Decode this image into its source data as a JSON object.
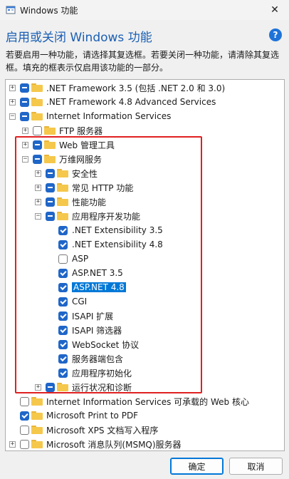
{
  "window": {
    "title": "Windows 功能",
    "close_glyph": "✕"
  },
  "heading": "启用或关闭 Windows 功能",
  "help_glyph": "?",
  "description": "若要启用一种功能，请选择其复选框。若要关闭一种功能，请清除其复选框。填充的框表示仅启用该功能的一部分。",
  "tree": [
    {
      "label": ".NET Framework 3.5 (包括 .NET 2.0 和 3.0)",
      "level": 0,
      "expander": "+",
      "state": "partial",
      "selected": false
    },
    {
      "label": ".NET Framework 4.8 Advanced Services",
      "level": 0,
      "expander": "+",
      "state": "partial",
      "selected": false
    },
    {
      "label": "Internet Information Services",
      "level": 0,
      "expander": "−",
      "state": "partial",
      "selected": false
    },
    {
      "label": "FTP 服务器",
      "level": 1,
      "expander": "+",
      "state": "unchecked",
      "selected": false
    },
    {
      "label": "Web 管理工具",
      "level": 1,
      "expander": "+",
      "state": "partial",
      "selected": false
    },
    {
      "label": "万维网服务",
      "level": 1,
      "expander": "−",
      "state": "partial",
      "selected": false
    },
    {
      "label": "安全性",
      "level": 2,
      "expander": "+",
      "state": "partial",
      "selected": false
    },
    {
      "label": "常见 HTTP 功能",
      "level": 2,
      "expander": "+",
      "state": "partial",
      "selected": false
    },
    {
      "label": "性能功能",
      "level": 2,
      "expander": "+",
      "state": "partial",
      "selected": false
    },
    {
      "label": "应用程序开发功能",
      "level": 2,
      "expander": "−",
      "state": "partial",
      "selected": false
    },
    {
      "label": ".NET Extensibility 3.5",
      "level": 3,
      "expander": "",
      "state": "checked",
      "selected": false
    },
    {
      "label": ".NET Extensibility 4.8",
      "level": 3,
      "expander": "",
      "state": "checked",
      "selected": false
    },
    {
      "label": "ASP",
      "level": 3,
      "expander": "",
      "state": "unchecked",
      "selected": false
    },
    {
      "label": "ASP.NET 3.5",
      "level": 3,
      "expander": "",
      "state": "checked",
      "selected": false
    },
    {
      "label": "ASP.NET 4.8",
      "level": 3,
      "expander": "",
      "state": "checked",
      "selected": true
    },
    {
      "label": "CGI",
      "level": 3,
      "expander": "",
      "state": "checked",
      "selected": false
    },
    {
      "label": "ISAPI 扩展",
      "level": 3,
      "expander": "",
      "state": "checked",
      "selected": false
    },
    {
      "label": "ISAPI 筛选器",
      "level": 3,
      "expander": "",
      "state": "checked",
      "selected": false
    },
    {
      "label": "WebSocket 协议",
      "level": 3,
      "expander": "",
      "state": "checked",
      "selected": false
    },
    {
      "label": "服务器端包含",
      "level": 3,
      "expander": "",
      "state": "checked",
      "selected": false
    },
    {
      "label": "应用程序初始化",
      "level": 3,
      "expander": "",
      "state": "checked",
      "selected": false
    },
    {
      "label": "运行状况和诊断",
      "level": 2,
      "expander": "+",
      "state": "partial",
      "selected": false
    },
    {
      "label": "Internet Information Services 可承载的 Web 核心",
      "level": 0,
      "expander": "",
      "state": "unchecked",
      "selected": false
    },
    {
      "label": "Microsoft Print to PDF",
      "level": 0,
      "expander": "",
      "state": "checked",
      "selected": false
    },
    {
      "label": "Microsoft XPS 文档写入程序",
      "level": 0,
      "expander": "",
      "state": "unchecked",
      "selected": false
    },
    {
      "label": "Microsoft 消息队列(MSMQ)服务器",
      "level": 0,
      "expander": "+",
      "state": "unchecked",
      "selected": false
    }
  ],
  "buttons": {
    "ok": "确定",
    "cancel": "取消"
  },
  "colors": {
    "accent": "#1f66c8",
    "heading": "#1a5fb4",
    "selection": "#0078d7",
    "highlight_box": "#e02020",
    "folder": "#f5c84c"
  }
}
